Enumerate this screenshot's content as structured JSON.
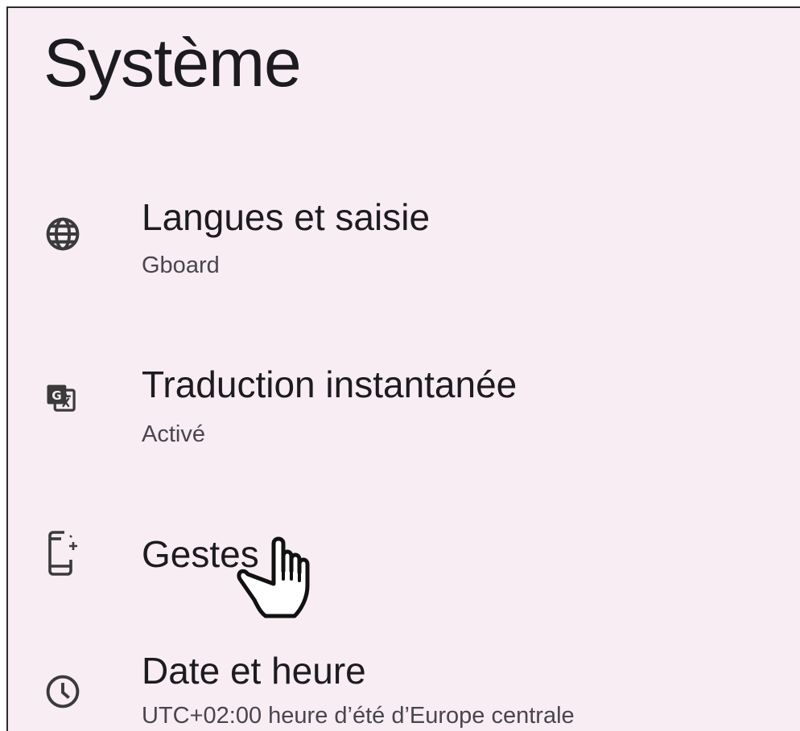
{
  "page": {
    "title": "Système"
  },
  "settings_items": [
    {
      "label": "Langues et saisie",
      "summary": "Gboard",
      "icon": "globe-icon"
    },
    {
      "label": "Traduction instantanée",
      "summary": "Activé",
      "icon": "translate-icon"
    },
    {
      "label": "Gestes",
      "summary": "",
      "icon": "phone-gesture-icon"
    },
    {
      "label": "Date et heure",
      "summary": "UTC+02:00 heure d’été d’Europe centrale",
      "icon": "clock-icon"
    }
  ],
  "cursor": {
    "icon": "hand-pointer-icon"
  },
  "colors": {
    "background": "#f7edf3",
    "text_primary": "#1c1b1f",
    "text_secondary": "#49454f",
    "icon": "#3a3a3a"
  }
}
